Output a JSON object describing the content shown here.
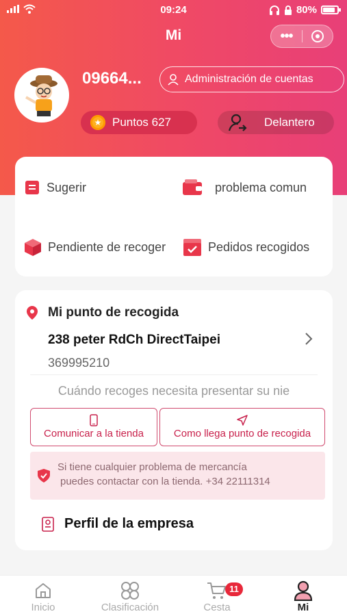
{
  "status_bar": {
    "time": "09:24",
    "battery": "80%"
  },
  "nav": {
    "title": "Mi",
    "more_label": "•••"
  },
  "profile": {
    "phone": "09664...",
    "account_button": "Administración de cuentas",
    "points": "Puntos 627",
    "level": "Delantero"
  },
  "services": {
    "items": [
      {
        "label": "Sugerir",
        "icon": "suggest-icon"
      },
      {
        "label": "problema comun",
        "icon": "wallet-icon"
      },
      {
        "label": "Pendiente de recoger",
        "icon": "box-icon"
      },
      {
        "label": "Pedidos recogidos",
        "icon": "checked-box-icon"
      }
    ]
  },
  "pickup": {
    "title": "Mi punto de recogida",
    "address": "238 peter RdCh DirectTaipei",
    "phone": "369995210",
    "hint": "Cuándo recoges necesita presentar su nie",
    "contact_button": "Comunicar a la tienda",
    "directions_button": "Como llega punto de recogida",
    "notice_line1": "Si tiene cualquier problema de mercancía",
    "notice_line2": "puedes contactar con la tienda. +34 22111314",
    "company_profile": "Perfil de la empresa"
  },
  "tabbar": {
    "tabs": [
      {
        "label": "Inicio",
        "icon": "home-icon"
      },
      {
        "label": "Clasificación",
        "icon": "category-icon"
      },
      {
        "label": "Cesta",
        "icon": "cart-icon",
        "badge": "11"
      },
      {
        "label": "Mi",
        "icon": "user-icon",
        "active": true
      }
    ]
  },
  "colors": {
    "brand": "#ef4a5c",
    "accent_red": "#e8283a"
  }
}
